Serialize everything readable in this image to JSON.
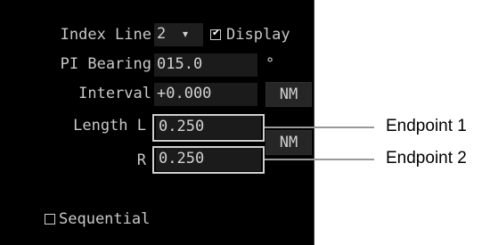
{
  "index_line": {
    "label": "Index Line",
    "value": "2",
    "display_label": "Display",
    "display_checked": true
  },
  "pi_bearing": {
    "label": "PI Bearing",
    "value": "015.0",
    "unit": "°"
  },
  "interval": {
    "label": "Interval",
    "value": "+0.000",
    "unit": "NM"
  },
  "length": {
    "label": "Length L",
    "left_value": "0.250",
    "right_label": "R",
    "right_value": "0.250",
    "unit": "NM"
  },
  "sequential": {
    "label": "Sequential",
    "checked": false
  },
  "callouts": {
    "endpoint1": "Endpoint 1",
    "endpoint2": "Endpoint 2"
  }
}
